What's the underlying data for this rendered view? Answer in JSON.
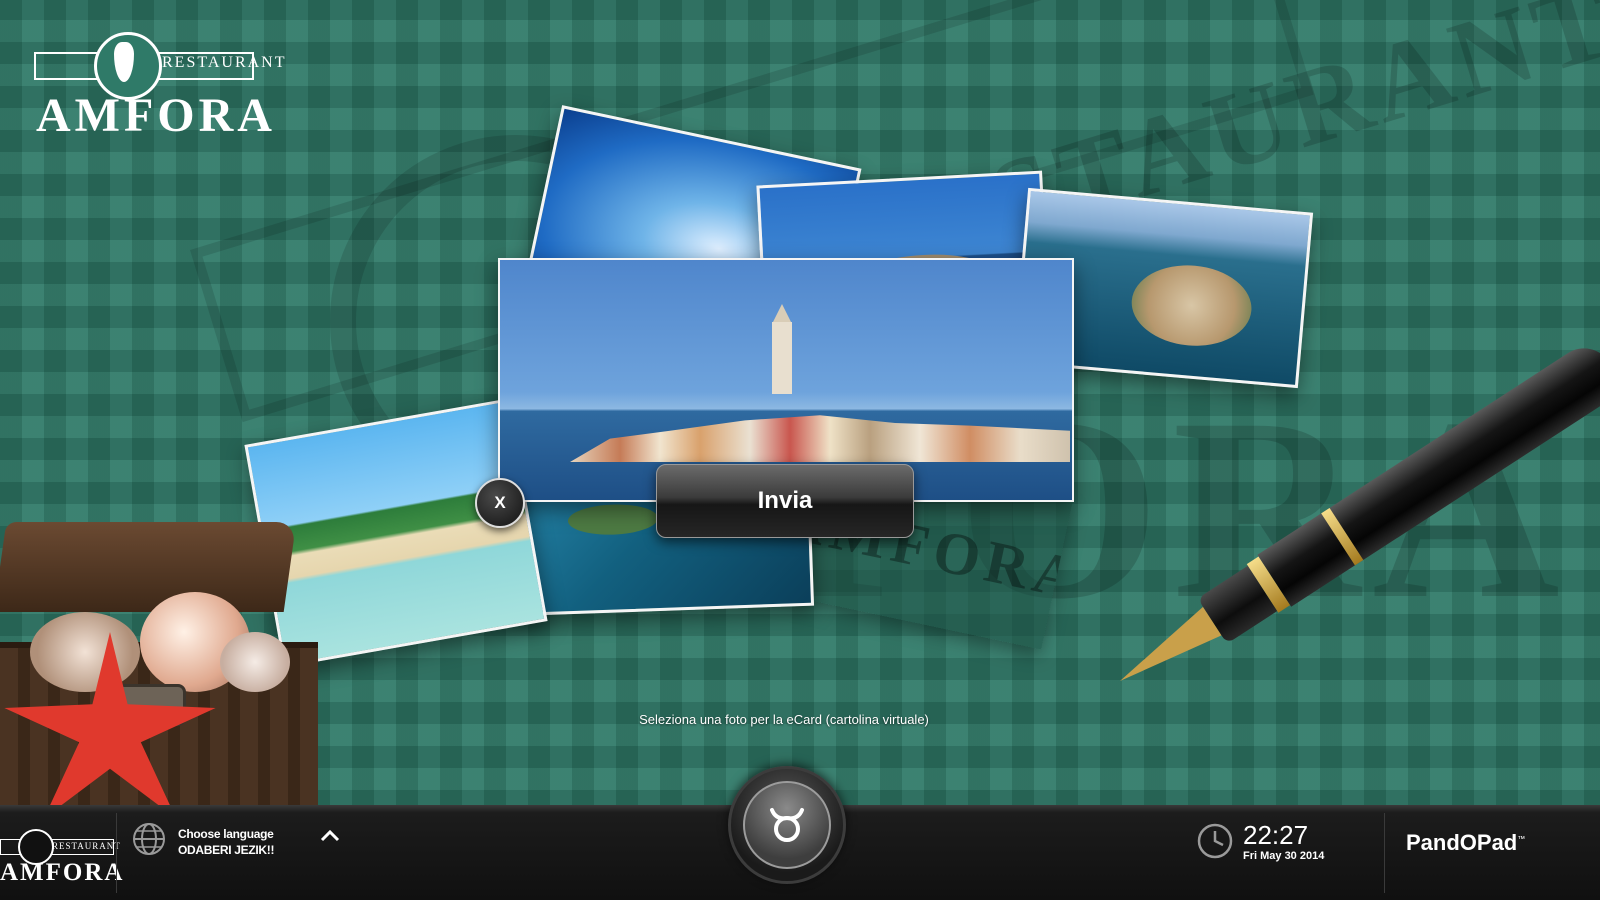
{
  "logo": {
    "top_text": "RESTAURANT",
    "name": "AMFORA"
  },
  "watermark": {
    "top_text": "RESTAURANT",
    "big_text": "AMFORA"
  },
  "cards": [
    {
      "name": "sky-photo"
    },
    {
      "name": "tower-island-photo"
    },
    {
      "name": "aerial-town-photo"
    },
    {
      "name": "islands-photo"
    },
    {
      "name": "beach-photo"
    },
    {
      "name": "rovinj-main-photo"
    }
  ],
  "stamp_text": "AMFORA",
  "actions": {
    "close_label": "X",
    "send_label": "Invia"
  },
  "hint": "Seleziona una foto per la eCard (cartolina virtuale)",
  "taskbar": {
    "logo_top": "RESTAURANT",
    "logo_name": "AMFORA",
    "language_line1": "Choose language",
    "language_line2": "ODABERI JEZIK!!",
    "time": "22:27",
    "date": "Fri May 30 2014",
    "brand": "PandOPad",
    "brand_tm": "™"
  },
  "icons": [
    "globe-icon",
    "chevron-up-icon",
    "taurus-icon",
    "clock-icon",
    "amphora-icon"
  ],
  "colors": {
    "background": "#2f7a68",
    "taskbar": "#101010",
    "accent_star": "#e0392d"
  }
}
